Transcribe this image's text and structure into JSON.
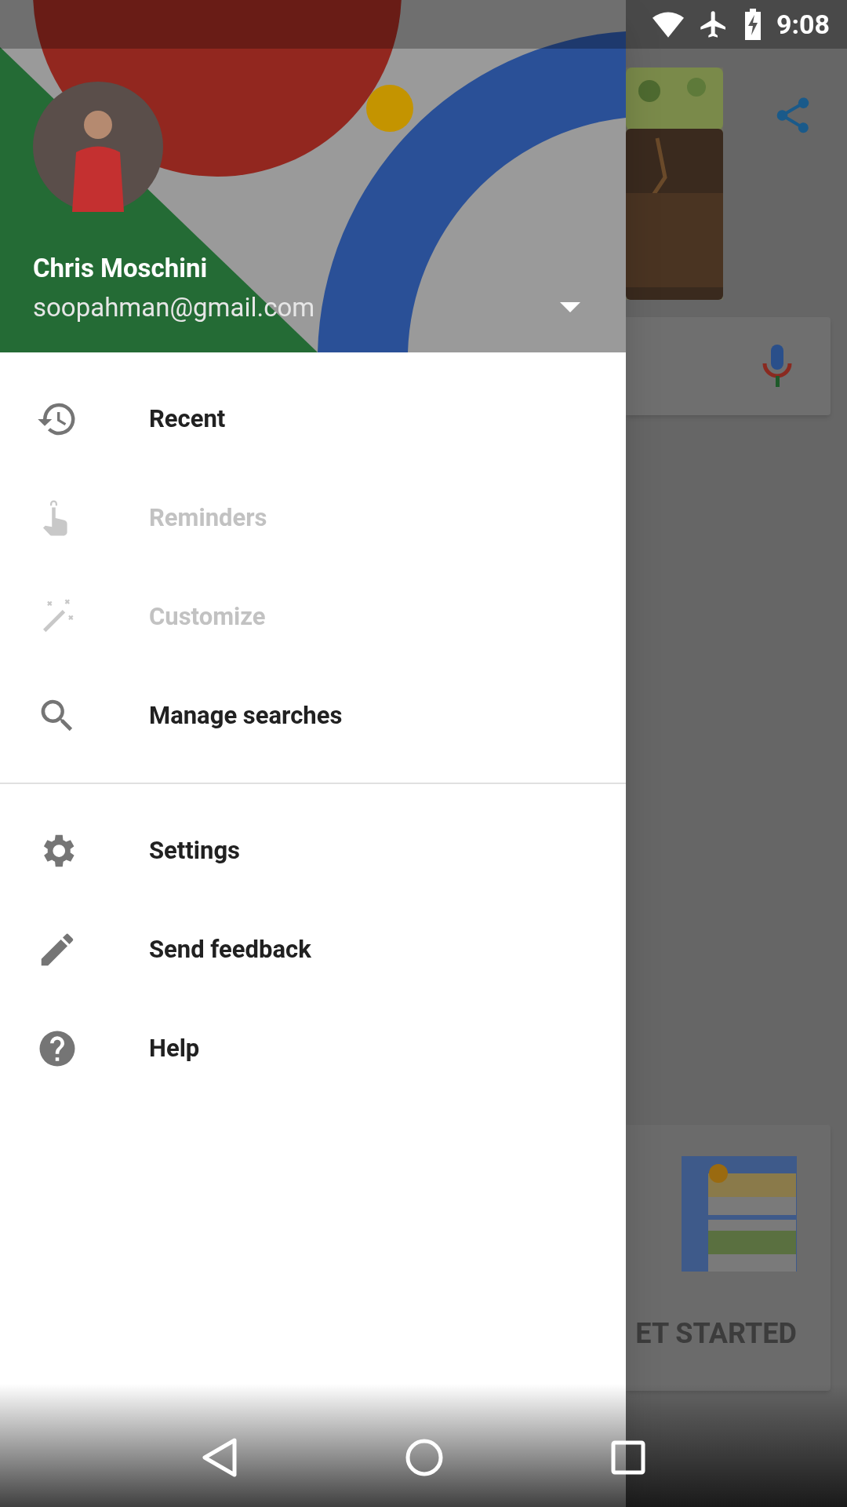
{
  "status_bar": {
    "time": "9:08"
  },
  "account": {
    "name": "Chris Moschini",
    "email": "soopahman@gmail.com"
  },
  "menu_sections": [
    {
      "items": [
        {
          "label": "Recent",
          "disabled": false
        },
        {
          "label": "Reminders",
          "disabled": true
        },
        {
          "label": "Customize",
          "disabled": true
        },
        {
          "label": "Manage searches",
          "disabled": false
        }
      ]
    },
    {
      "items": [
        {
          "label": "Settings",
          "disabled": false
        },
        {
          "label": "Send feedback",
          "disabled": false
        },
        {
          "label": "Help",
          "disabled": false
        }
      ]
    }
  ],
  "background_app": {
    "card_button": "ET STARTED"
  }
}
